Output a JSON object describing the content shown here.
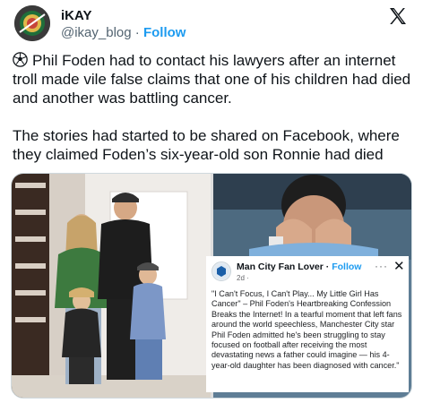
{
  "author": {
    "name": "iKAY",
    "handle": "@ikay_blog",
    "separator": "·",
    "follow_label": "Follow"
  },
  "tweet": {
    "line1": "Phil Foden had to contact his lawyers after an internet troll made vile false claims that one of his children had died and another was battling cancer.",
    "line2": "The stories had started to be shared on Facebook, where they claimed Foden’s six-year-old son Ronnie had died"
  },
  "fb_card": {
    "page_name": "Man City Fan Lover",
    "separator": "·",
    "follow_label": "Follow",
    "time": "2d ·",
    "dots": "···",
    "close": "✕",
    "body": "\"I Can't Focus, I Can't Play... My Little Girl Has Cancer\" – Phil Foden's Heartbreaking Confession Breaks the Internet! In a tearful moment that left fans around the world speechless, Manchester City star Phil Foden admitted he's been struggling to stay focused on football after receiving the most devastating news a father could imagine — his 4-year-old daughter has been diagnosed with cancer.\""
  },
  "icons": {
    "brand": "x-logo-icon",
    "emoji": "soccer-ball-icon"
  }
}
